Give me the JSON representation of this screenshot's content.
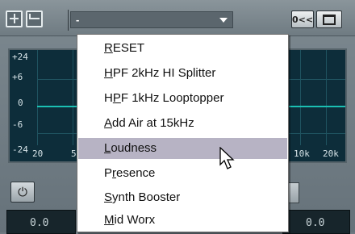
{
  "toolbar": {
    "preset_value": "-",
    "btn_compare": "0<<"
  },
  "eq_display": {
    "y_labels": [
      "+24",
      "+6",
      "0",
      "-6",
      "-24"
    ],
    "x_labels": [
      "20",
      "5",
      "10k",
      "20k"
    ]
  },
  "readouts": {
    "left": "0.0",
    "right": "0.0"
  },
  "menu": {
    "items": [
      {
        "acc": "R",
        "rest": "ESET",
        "pre": ""
      },
      {
        "acc": "H",
        "rest": "PF 2kHz HI Splitter",
        "pre": ""
      },
      {
        "acc": "P",
        "rest": "F 1kHz Looptopper",
        "pre": "H"
      },
      {
        "acc": "A",
        "rest": "dd Air at 15kHz",
        "pre": ""
      },
      {
        "acc": "L",
        "rest": "oudness",
        "pre": ""
      },
      {
        "acc": "r",
        "rest": "esence",
        "pre": "P"
      },
      {
        "acc": "S",
        "rest": "ynth Booster",
        "pre": ""
      },
      {
        "acc": "M",
        "rest": "id Worx",
        "pre": ""
      }
    ],
    "highlighted_index": 4
  },
  "colors": {
    "highlight": "#b7b3c4",
    "display_bg": "#0d2d3a",
    "curve": "#1bbfb2"
  }
}
